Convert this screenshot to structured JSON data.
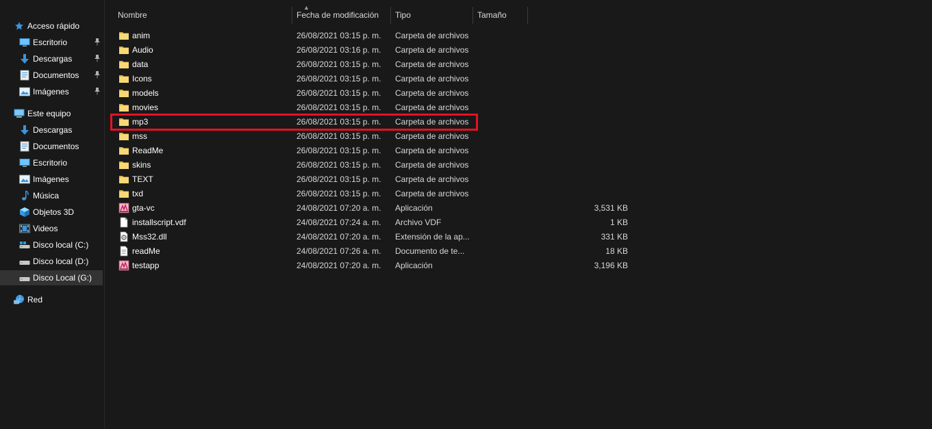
{
  "sidebar": {
    "items": [
      {
        "label": "Acceso rápido",
        "icon": "star-icon",
        "pinned": false
      },
      {
        "label": "Escritorio",
        "icon": "desktop-icon",
        "pinned": true
      },
      {
        "label": "Descargas",
        "icon": "download-icon",
        "pinned": true
      },
      {
        "label": "Documentos",
        "icon": "documents-icon",
        "pinned": true
      },
      {
        "label": "Imágenes",
        "icon": "pictures-icon",
        "pinned": true
      },
      {
        "label": "Este equipo",
        "icon": "computer-icon",
        "pinned": false
      },
      {
        "label": "Descargas",
        "icon": "download-icon",
        "pinned": false
      },
      {
        "label": "Documentos",
        "icon": "documents-icon",
        "pinned": false
      },
      {
        "label": "Escritorio",
        "icon": "desktop-icon",
        "pinned": false
      },
      {
        "label": "Imágenes",
        "icon": "pictures-icon",
        "pinned": false
      },
      {
        "label": "Música",
        "icon": "music-icon",
        "pinned": false
      },
      {
        "label": "Objetos 3D",
        "icon": "cube-icon",
        "pinned": false
      },
      {
        "label": "Videos",
        "icon": "video-icon",
        "pinned": false
      },
      {
        "label": "Disco local (C:)",
        "icon": "drive-c-icon",
        "pinned": false
      },
      {
        "label": "Disco local (D:)",
        "icon": "drive-icon",
        "pinned": false
      },
      {
        "label": "Disco Local (G:)",
        "icon": "drive-icon",
        "pinned": false,
        "selected": true
      },
      {
        "label": "Red",
        "icon": "network-icon",
        "pinned": false
      }
    ]
  },
  "columns": {
    "name": "Nombre",
    "date": "Fecha de modificación",
    "type": "Tipo",
    "size": "Tamaño"
  },
  "files": [
    {
      "name": "anim",
      "date": "26/08/2021 03:15 p. m.",
      "type": "Carpeta de archivos",
      "size": "",
      "icon": "folder-icon"
    },
    {
      "name": "Audio",
      "date": "26/08/2021 03:16 p. m.",
      "type": "Carpeta de archivos",
      "size": "",
      "icon": "folder-icon"
    },
    {
      "name": "data",
      "date": "26/08/2021 03:15 p. m.",
      "type": "Carpeta de archivos",
      "size": "",
      "icon": "folder-icon"
    },
    {
      "name": "Icons",
      "date": "26/08/2021 03:15 p. m.",
      "type": "Carpeta de archivos",
      "size": "",
      "icon": "folder-icon"
    },
    {
      "name": "models",
      "date": "26/08/2021 03:15 p. m.",
      "type": "Carpeta de archivos",
      "size": "",
      "icon": "folder-icon"
    },
    {
      "name": "movies",
      "date": "26/08/2021 03:15 p. m.",
      "type": "Carpeta de archivos",
      "size": "",
      "icon": "folder-icon"
    },
    {
      "name": "mp3",
      "date": "26/08/2021 03:15 p. m.",
      "type": "Carpeta de archivos",
      "size": "",
      "icon": "folder-icon"
    },
    {
      "name": "mss",
      "date": "26/08/2021 03:15 p. m.",
      "type": "Carpeta de archivos",
      "size": "",
      "icon": "folder-icon"
    },
    {
      "name": "ReadMe",
      "date": "26/08/2021 03:15 p. m.",
      "type": "Carpeta de archivos",
      "size": "",
      "icon": "folder-icon"
    },
    {
      "name": "skins",
      "date": "26/08/2021 03:15 p. m.",
      "type": "Carpeta de archivos",
      "size": "",
      "icon": "folder-icon"
    },
    {
      "name": "TEXT",
      "date": "26/08/2021 03:15 p. m.",
      "type": "Carpeta de archivos",
      "size": "",
      "icon": "folder-icon"
    },
    {
      "name": "txd",
      "date": "26/08/2021 03:15 p. m.",
      "type": "Carpeta de archivos",
      "size": "",
      "icon": "folder-icon"
    },
    {
      "name": "gta-vc",
      "date": "24/08/2021 07:20 a. m.",
      "type": "Aplicación",
      "size": "3,531 KB",
      "icon": "application-icon"
    },
    {
      "name": "installscript.vdf",
      "date": "24/08/2021 07:24 a. m.",
      "type": "Archivo VDF",
      "size": "1 KB",
      "icon": "file-icon"
    },
    {
      "name": "Mss32.dll",
      "date": "24/08/2021 07:20 a. m.",
      "type": "Extensión de la ap...",
      "size": "331 KB",
      "icon": "dll-icon"
    },
    {
      "name": "readMe",
      "date": "24/08/2021 07:26 a. m.",
      "type": "Documento de te...",
      "size": "18 KB",
      "icon": "text-document-icon"
    },
    {
      "name": "testapp",
      "date": "24/08/2021 07:20 a. m.",
      "type": "Aplicación",
      "size": "3,196 KB",
      "icon": "application-icon"
    }
  ],
  "colors": {
    "background": "#191919",
    "highlight_box": "#e81123",
    "folder": "#f8d775",
    "selected_nav": "#333333"
  }
}
